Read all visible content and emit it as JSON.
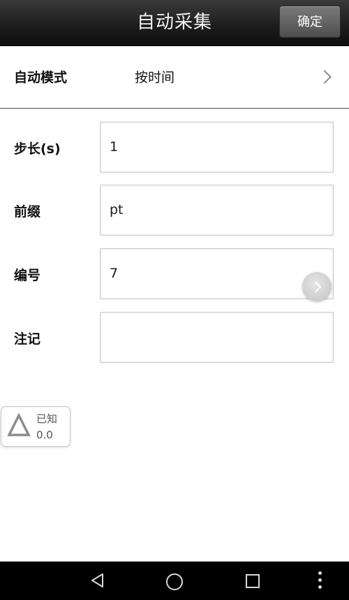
{
  "header": {
    "title": "自动采集",
    "confirm_label": "确定"
  },
  "mode": {
    "label": "自动模式",
    "value": "按时间",
    "icon": "chevron-right-icon"
  },
  "form": {
    "step": {
      "label": "步长(s)",
      "value": "1"
    },
    "prefix": {
      "label": "前缀",
      "value": "pt"
    },
    "number": {
      "label": "编号",
      "value": "7"
    },
    "note": {
      "label": "注记",
      "value": ""
    }
  },
  "floating_button": {
    "icon": "chevron-right-icon"
  },
  "status_badge": {
    "icon": "triangle-icon",
    "label": "已知",
    "value": "0.0"
  },
  "navbar": {
    "icons": [
      "back-icon",
      "home-icon",
      "recent-apps-icon",
      "overflow-menu-icon"
    ]
  },
  "colors": {
    "header_bg": "#1e1e1e",
    "header_text": "#f2f2f2",
    "divider": "#9a9a9a",
    "field_border": "#c9c9c9",
    "navbar_bg": "#000000"
  }
}
